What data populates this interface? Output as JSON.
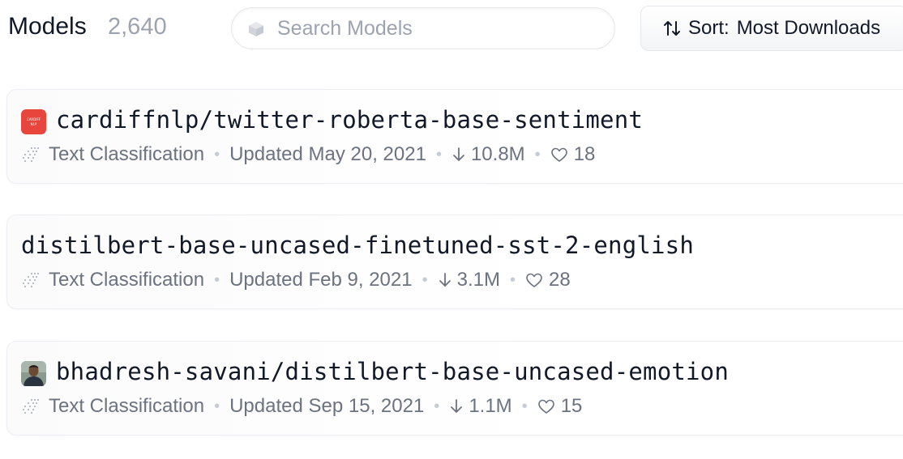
{
  "header": {
    "title": "Models",
    "count": "2,640"
  },
  "search": {
    "placeholder": "Search Models",
    "value": ""
  },
  "sort": {
    "prefix": "Sort:",
    "value": "Most Downloads"
  },
  "models": [
    {
      "name": "cardiffnlp/twitter-roberta-base-sentiment",
      "avatar": "cardiffnlp-logo",
      "task": "Text Classification",
      "updated": "Updated May 20, 2021",
      "downloads": "10.8M",
      "likes": "18",
      "avatar_text": "CARDIFF NLP"
    },
    {
      "name": "distilbert-base-uncased-finetuned-sst-2-english",
      "avatar": null,
      "task": "Text Classification",
      "updated": "Updated Feb 9, 2021",
      "downloads": "3.1M",
      "likes": "28"
    },
    {
      "name": "bhadresh-savani/distilbert-base-uncased-emotion",
      "avatar": "user-photo",
      "task": "Text Classification",
      "updated": "Updated Sep 15, 2021",
      "downloads": "1.1M",
      "likes": "15"
    }
  ],
  "icons": {
    "search": "cube-icon",
    "sort": "sort-arrows-icon",
    "task": "text-classification-icon",
    "downloads": "download-arrow-icon",
    "likes": "heart-icon"
  },
  "colors": {
    "cardiff_red": "#e8453c",
    "meta_text": "#6b7280",
    "count_text": "#9ca3af"
  }
}
